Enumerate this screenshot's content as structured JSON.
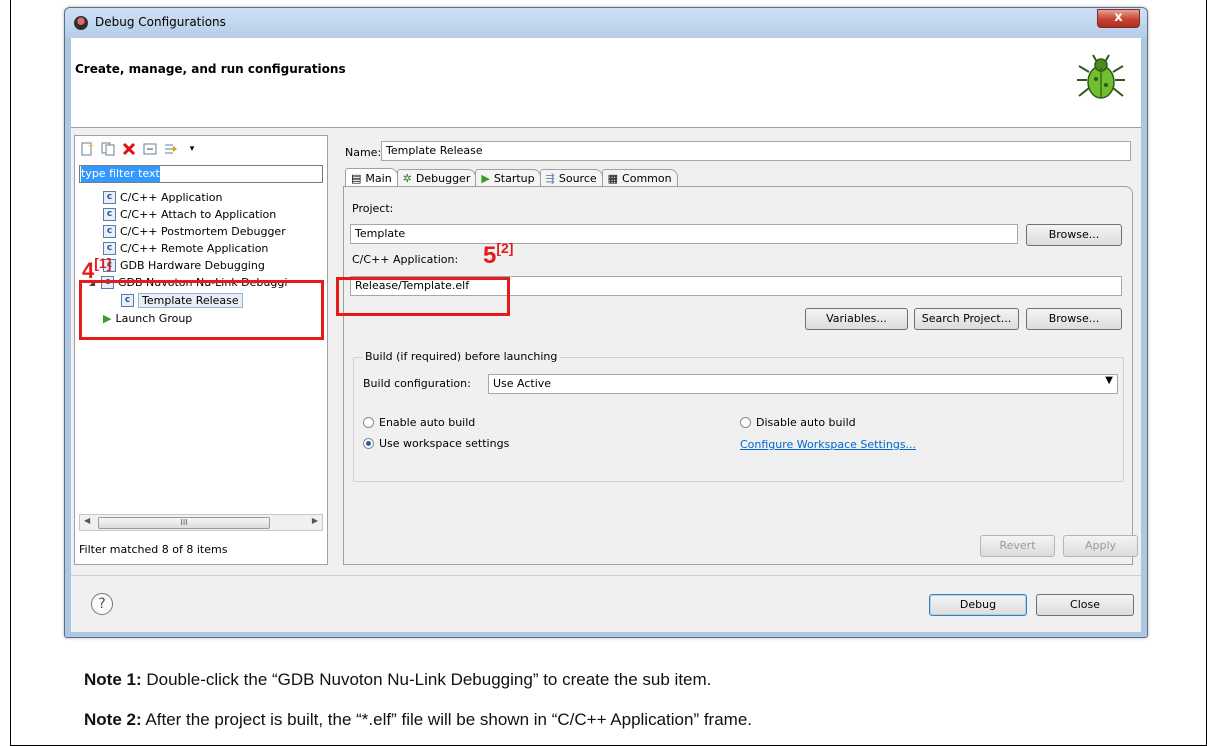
{
  "window": {
    "title": "Debug Configurations",
    "close_label": "x",
    "heading": "Create, manage, and run configurations"
  },
  "left": {
    "filter_text": "type filter text",
    "tree": [
      {
        "label": "C/C++ Application"
      },
      {
        "label": "C/C++ Attach to Application"
      },
      {
        "label": "C/C++ Postmortem Debugger"
      },
      {
        "label": "C/C++ Remote Application"
      },
      {
        "label": "GDB Hardware Debugging"
      },
      {
        "label": "GDB Nuvoton Nu-Link Debuggi"
      },
      {
        "label": "Template Release"
      },
      {
        "label": "Launch Group"
      }
    ],
    "scroll_mark": "III",
    "status": "Filter matched 8 of 8 items"
  },
  "right": {
    "name_label": "Name:",
    "name_value": "Template Release",
    "tabs": [
      "Main",
      "Debugger",
      "Startup",
      "Source",
      "Common"
    ],
    "project_label": "Project:",
    "project_value": "Template",
    "browse1": "Browse...",
    "app_label": "C/C++ Application:",
    "app_value": "Release/Template.elf",
    "variables": "Variables...",
    "search_project": "Search Project...",
    "browse2": "Browse...",
    "build_legend": "Build (if required) before launching",
    "build_config_label": "Build configuration:",
    "build_config_value": "Use Active",
    "enable_auto": "Enable auto build",
    "disable_auto": "Disable auto build",
    "use_workspace": "Use workspace settings",
    "configure_link": "Configure Workspace Settings...",
    "revert": "Revert",
    "apply": "Apply"
  },
  "bottom": {
    "help": "?",
    "debug": "Debug",
    "close": "Close"
  },
  "annotations": {
    "a4": "4",
    "a4_ref": "[1]",
    "a5": "5",
    "a5_ref": "[2]"
  },
  "notes": [
    {
      "label": "Note 1:",
      "text": " Double-click the “GDB Nuvoton Nu-Link Debugging” to create the sub item."
    },
    {
      "label": "Note 2:",
      "text": " After the project is built, the “*.elf” file will be shown in “C/C++ Application” frame."
    }
  ],
  "colors": {
    "annotation_red": "#e31b1b",
    "link_blue": "#0066cc",
    "selection_blue": "#3399ff"
  }
}
